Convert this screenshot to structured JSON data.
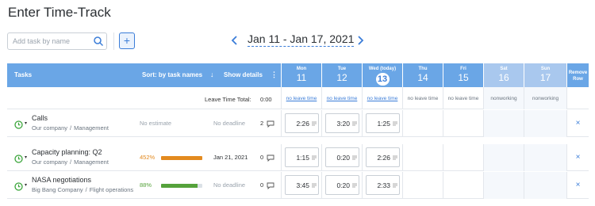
{
  "page_title": "Enter Time-Track",
  "toolbar": {
    "search_placeholder": "Add task by name",
    "add_label": "+"
  },
  "date_nav": {
    "range": "Jan 11 - Jan 17, 2021"
  },
  "header": {
    "tasks_label": "Tasks",
    "sort_label": "Sort: by task names",
    "sort_arrow": "↓",
    "details_label": "Show details",
    "details_menu": "⋮",
    "remove_label_1": "Remove",
    "remove_label_2": "Row",
    "days": [
      {
        "name": "Mon",
        "num": "11",
        "today": false,
        "nonworking": false
      },
      {
        "name": "Tue",
        "num": "12",
        "today": false,
        "nonworking": false
      },
      {
        "name": "Wed (today)",
        "num": "13",
        "today": true,
        "nonworking": false
      },
      {
        "name": "Thu",
        "num": "14",
        "today": false,
        "nonworking": false
      },
      {
        "name": "Fri",
        "num": "15",
        "today": false,
        "nonworking": false
      },
      {
        "name": "Sat",
        "num": "16",
        "today": false,
        "nonworking": true
      },
      {
        "name": "Sun",
        "num": "17",
        "today": false,
        "nonworking": true
      }
    ]
  },
  "leave": {
    "label": "Leave Time Total:",
    "total": "0:00",
    "cells": [
      "no leave time",
      "no leave time",
      "no leave time",
      "no leave time",
      "no leave time",
      "nonworking",
      "nonworking"
    ]
  },
  "tasks": [
    {
      "name": "Calls",
      "company": "Our company",
      "project": "Management",
      "estimate": "No estimate",
      "progress": null,
      "deadline": "No deadline",
      "comments": "2",
      "times": [
        "2:26",
        "3:20",
        "1:25",
        "",
        "",
        "",
        ""
      ]
    },
    {
      "name": "Capacity planning: Q2",
      "company": "Our company",
      "project": "Management",
      "estimate": "452%",
      "progress": 1.0,
      "deadline": "Jan 21, 2021",
      "comments": "0",
      "times": [
        "1:15",
        "0:20",
        "2:26",
        "",
        "",
        "",
        ""
      ]
    },
    {
      "name": "NASA negotiations",
      "company": "Big Bang Company",
      "project": "Flight operations",
      "estimate": "88%",
      "progress": 0.88,
      "deadline": "No deadline",
      "comments": "0",
      "times": [
        "3:45",
        "0:20",
        "2:33",
        "",
        "",
        "",
        ""
      ]
    }
  ],
  "colors": {
    "header_bg": "#6aa6e6",
    "accent": "#3b7dd8",
    "over_estimate": "#e38a1f",
    "on_track": "#55a23b",
    "clock_green": "#3aa53a"
  },
  "remove_icon": "×",
  "path_separator": "/"
}
